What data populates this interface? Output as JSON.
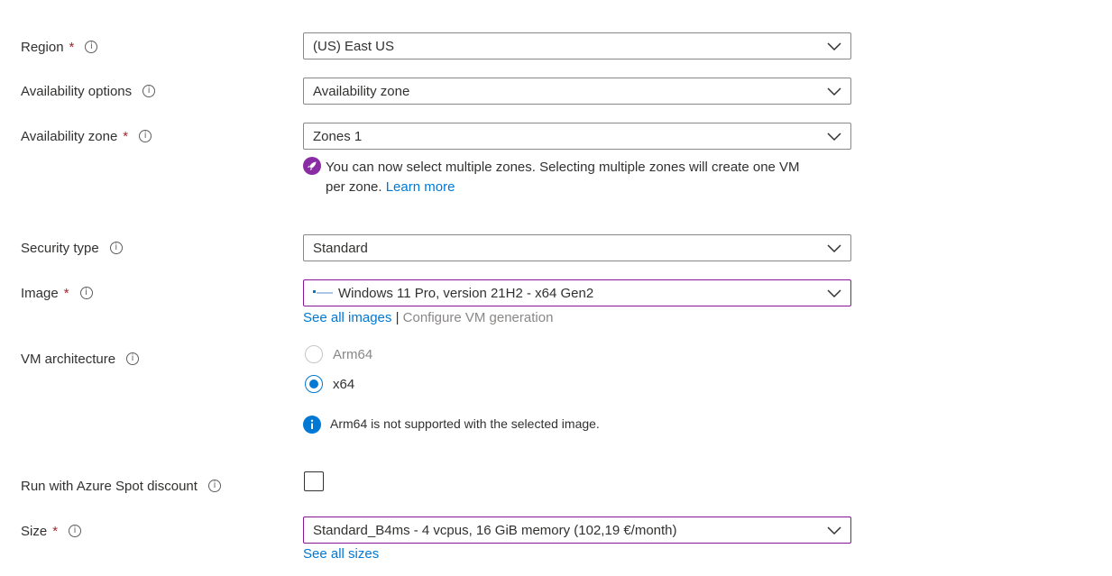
{
  "fields": {
    "region": {
      "label": "Region",
      "required_mark": "*",
      "value": "(US) East US"
    },
    "availability_options": {
      "label": "Availability options",
      "value": "Availability zone"
    },
    "availability_zone": {
      "label": "Availability zone",
      "required_mark": "*",
      "value": "Zones 1",
      "notice_line1": "You can now select multiple zones. Selecting multiple zones will create one VM",
      "notice_line2": "per zone.",
      "learn_more": "Learn more"
    },
    "security_type": {
      "label": "Security type",
      "value": "Standard"
    },
    "image": {
      "label": "Image",
      "required_mark": "*",
      "value": "Windows 11 Pro, version 21H2 - x64 Gen2",
      "see_all": "See all images",
      "separator": "|",
      "configure": "Configure VM generation"
    },
    "vm_architecture": {
      "label": "VM architecture",
      "options": [
        "Arm64",
        "x64"
      ],
      "selected": "x64",
      "info_text": "Arm64 is not supported with the selected image."
    },
    "spot": {
      "label": "Run with Azure Spot discount",
      "checked": false
    },
    "size": {
      "label": "Size",
      "required_mark": "*",
      "value": "Standard_B4ms - 4 vcpus, 16 GiB memory (102,19 €/month)",
      "see_all": "See all sizes"
    }
  },
  "icons": {
    "info": "info-circle-icon",
    "chevron": "chevron-down-icon",
    "rocket": "rocket-icon",
    "windows": "windows-logo-icon"
  },
  "colors": {
    "link": "#0078d4",
    "required": "#a4262c",
    "focus_border": "#881798",
    "rocket_badge": "#8a2da5"
  }
}
